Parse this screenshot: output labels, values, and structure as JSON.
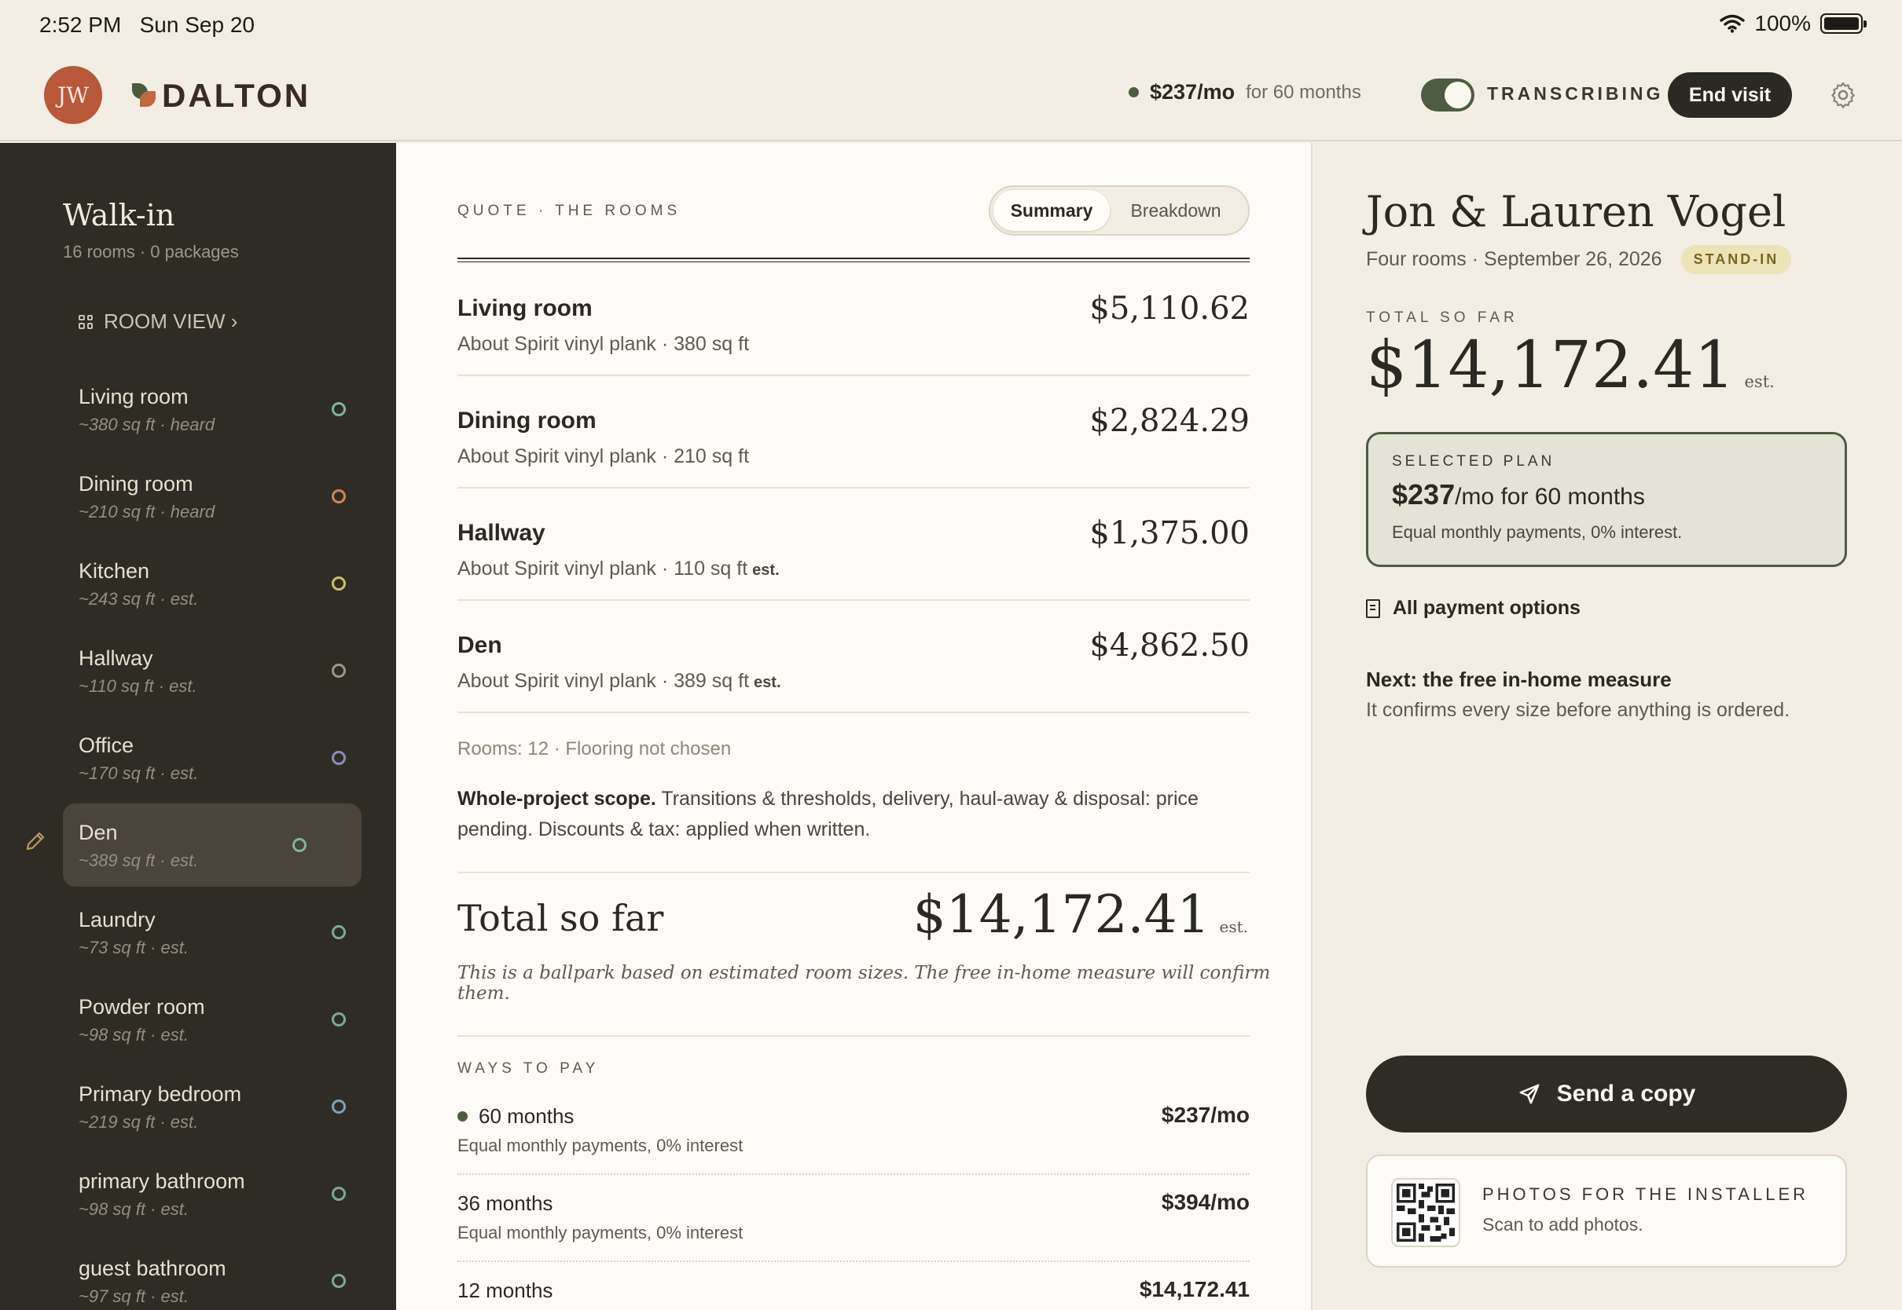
{
  "status_bar": {
    "time": "2:52 PM",
    "date": "Sun Sep 20",
    "battery": "100%"
  },
  "header": {
    "avatar_initials": "JW",
    "logo_text": "DALTON",
    "plan_price": "$237/mo",
    "plan_term": "for 60 months",
    "transcribing_label": "TRANSCRIBING",
    "transcribing_on": true,
    "end_visit_label": "End visit"
  },
  "sidebar": {
    "title": "Walk-in",
    "subtitle": "16 rooms · 0 packages",
    "room_view_label": "ROOM VIEW ›",
    "rooms": [
      {
        "name": "Living room",
        "meta": "~380 sq ft · heard",
        "status_color": "#7fb59a"
      },
      {
        "name": "Dining room",
        "meta": "~210 sq ft · heard",
        "status_color": "#c9875a"
      },
      {
        "name": "Kitchen",
        "meta": "~243 sq ft · est.",
        "status_color": "#c9c35a"
      },
      {
        "name": "Hallway",
        "meta": "~110 sq ft · est.",
        "status_color": "#9d978a"
      },
      {
        "name": "Office",
        "meta": "~170 sq ft · est.",
        "status_color": "#8a8fb8"
      },
      {
        "name": "Den",
        "meta": "~389 sq ft · est.",
        "status_color": "#7fb59a"
      },
      {
        "name": "Laundry",
        "meta": "~73 sq ft · est.",
        "status_color": "#7fa79c"
      },
      {
        "name": "Powder room",
        "meta": "~98 sq ft · est.",
        "status_color": "#7fa79c"
      },
      {
        "name": "Primary bedroom",
        "meta": "~219 sq ft · est.",
        "status_color": "#7fa0b3"
      },
      {
        "name": "primary bathroom",
        "meta": "~98 sq ft · est.",
        "status_color": "#7fa79c"
      },
      {
        "name": "guest bathroom",
        "meta": "~97 sq ft · est.",
        "status_color": "#7fa79c"
      }
    ],
    "active_room": "Den"
  },
  "main": {
    "eyebrow": "QUOTE · THE ROOMS",
    "tabs": [
      "Summary",
      "Breakdown"
    ],
    "active_tab": "Summary",
    "quote_rows": [
      {
        "name": "Living room",
        "desc": "About Spirit vinyl plank · 380 sq ft",
        "est": "",
        "price": "$5,110.62"
      },
      {
        "name": "Dining room",
        "desc": "About Spirit vinyl plank · 210 sq ft",
        "est": "",
        "price": "$2,824.29"
      },
      {
        "name": "Hallway",
        "desc": "About Spirit vinyl plank · 110 sq ft",
        "est": "est.",
        "price": "$1,375.00"
      },
      {
        "name": "Den",
        "desc": "About Spirit vinyl plank · 389 sq ft",
        "est": "est.",
        "price": "$4,862.50"
      }
    ],
    "rooms_note": "Rooms: 12 · Flooring not chosen",
    "scope_title": "Whole-project scope.",
    "scope_text": "Transitions & thresholds, delivery, haul-away & disposal: price pending. Discounts & tax: applied when written.",
    "total_label": "Total so far",
    "total_value": "$14,172.41",
    "total_est": "est.",
    "ballpark": "This is a ballpark based on estimated room sizes. The free in-home measure will confirm them.",
    "ways_to_pay_label": "WAYS TO PAY",
    "pay_options": [
      {
        "term": "60 months",
        "desc": "Equal monthly payments, 0% interest",
        "amount": "$237/mo",
        "selected": true
      },
      {
        "term": "36 months",
        "desc": "Equal monthly payments, 0% interest",
        "amount": "$394/mo",
        "selected": false
      },
      {
        "term": "12 months",
        "desc": "",
        "amount": "$14,172.41",
        "selected": false
      }
    ]
  },
  "right": {
    "client_name": "Jon & Lauren Vogel",
    "client_sub": "Four rooms · September 26, 2026",
    "badge": "STAND-IN",
    "total_label": "TOTAL SO FAR",
    "total_value": "$14,172.41",
    "total_est": "est.",
    "selected_plan_label": "SELECTED PLAN",
    "selected_plan_price": "$237",
    "selected_plan_rest": "/mo for 60 months",
    "selected_plan_desc": "Equal monthly payments, 0% interest.",
    "all_options_label": "All payment options",
    "next_title": "Next: the free in-home measure",
    "next_desc": "It confirms every size before anything is ordered.",
    "send_label": "Send a copy",
    "photos_title": "PHOTOS FOR THE INSTALLER",
    "photos_sub": "Scan to add photos."
  },
  "colors": {
    "accent": "#4d5c40",
    "dark": "#2f2c26",
    "brand": "#b9583a"
  }
}
